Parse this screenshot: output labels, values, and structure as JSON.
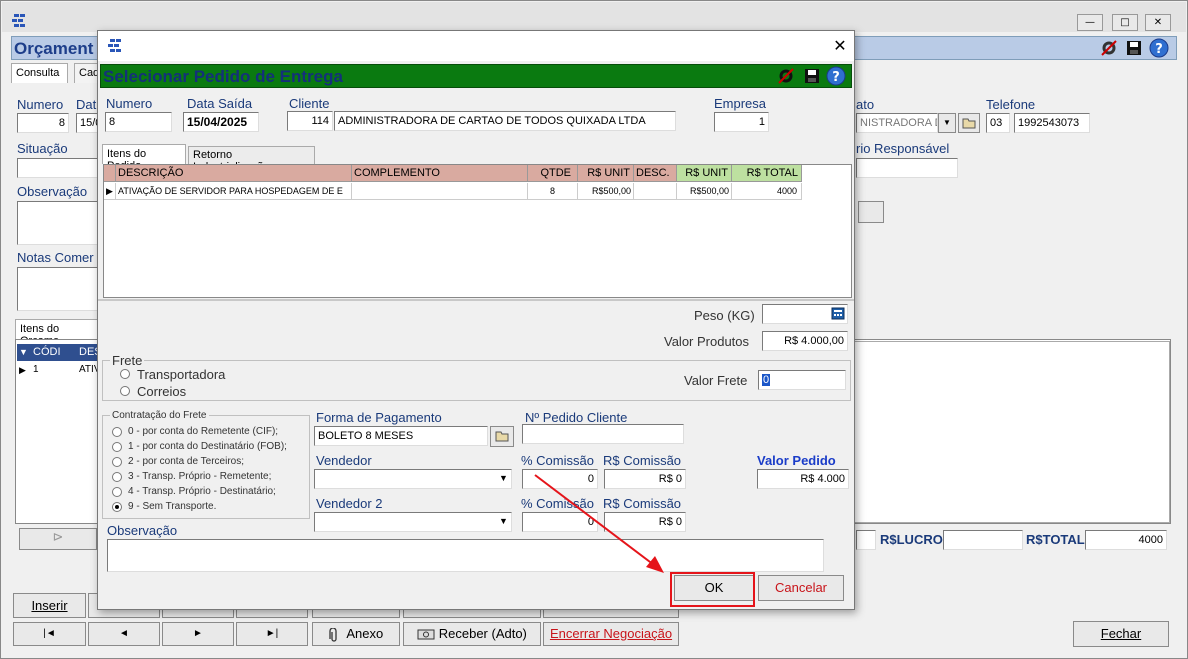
{
  "main": {
    "title": "Orçament",
    "tabs": [
      "Consulta",
      "Cad"
    ],
    "fields": {
      "numero_label": "Numero",
      "numero_value": "8",
      "data_label": "Dat",
      "data_value": "15/0",
      "situacao_label": "Situação",
      "observacao_label": "Observação",
      "notas_label": "Notas Comer",
      "contato_label": "ato",
      "contato_value": "NISTRADORA D",
      "telefone_label": "Telefone",
      "telefone_ddd": "03",
      "telefone_value": "1992543073",
      "responsavel_label": "rio Responsável"
    },
    "itens_tab": "Itens do Orçame",
    "grid_headers": [
      "CÓDI",
      "DES"
    ],
    "grid_row": [
      "1",
      "ATIV"
    ],
    "totals": {
      "lucro_label": "R$LUCRO",
      "total_label": "R$TOTAL",
      "total_value": "4000"
    },
    "buttons": {
      "inserir": "Inserir",
      "anexo": "Anexo",
      "receber": "Receber (Adto)",
      "encerrar": "Encerrar Negociação",
      "fechar": "Fechar",
      "first": "|◄",
      "prev": "◄",
      "next": "►",
      "last": "►|"
    }
  },
  "dialog": {
    "title": "Selecionar Pedido de Entrega",
    "numero_label": "Numero",
    "numero_value": "8",
    "data_saida_label": "Data Saída",
    "data_saida_value": "15/04/2025",
    "cliente_label": "Cliente",
    "cliente_code": "114",
    "cliente_name": "ADMINISTRADORA DE CARTAO DE TODOS QUIXADA LTDA",
    "empresa_label": "Empresa",
    "empresa_value": "1",
    "tabs": [
      "Itens do Pedido",
      "Retorno Industrialização"
    ],
    "grid": {
      "headers": [
        "DESCRIÇÃO",
        "COMPLEMENTO",
        "QTDE",
        "R$ UNIT",
        "DESC.",
        "R$ UNIT",
        "R$ TOTAL"
      ],
      "rows": [
        [
          "ATIVAÇÃO DE SERVIDOR PARA HOSPEDAGEM DE E",
          "",
          "8",
          "R$500,00",
          "",
          "R$500,00",
          "4000"
        ]
      ]
    },
    "peso_label": "Peso (KG)",
    "peso_value": "",
    "valor_produtos_label": "Valor Produtos",
    "valor_produtos_value": "R$ 4.000,00",
    "frete_label": "Frete",
    "frete_options": [
      "Transportadora",
      "Correios"
    ],
    "valor_frete_label": "Valor Frete",
    "valor_frete_value": "0",
    "contratacao_label": "Contratação do Frete",
    "contratacao_options": [
      "0 - por conta do Remetente (CIF);",
      "1 - por conta do Destinatário (FOB);",
      "2 - por conta de Terceiros;",
      "3 - Transp. Próprio - Remetente;",
      "4 - Transp. Próprio - Destinatário;",
      "9 - Sem Transporte."
    ],
    "contratacao_selected": 5,
    "forma_pagamento_label": "Forma de Pagamento",
    "forma_pagamento_value": "BOLETO 8 MESES",
    "pedido_cliente_label": "Nº Pedido Cliente",
    "pedido_cliente_value": "",
    "vendedor_label": "Vendedor",
    "vendedor_value": "",
    "pct_comissao_label": "% Comissão",
    "pct_comissao_value": "0",
    "rs_comissao_label": "R$ Comissão",
    "rs_comissao_value": "R$ 0",
    "valor_pedido_label": "Valor Pedido",
    "valor_pedido_value": "R$ 4.000",
    "vendedor2_label": "Vendedor 2",
    "vendedor2_value": "",
    "pct_comissao2_value": "0",
    "rs_comissao2_value": "R$ 0",
    "observacao_label": "Observação",
    "observacao_value": "",
    "ok_label": "OK",
    "cancelar_label": "Cancelar"
  },
  "colors": {
    "dialog_header": "#0a7a10",
    "main_header": "#b9cbe6",
    "annotation": "#e5141a",
    "valor_pedido": "#1a3cc8",
    "cancelar": "#c8141a"
  },
  "icons": [
    "app-logo-icon",
    "settings-icon",
    "save-icon",
    "help-icon",
    "close-icon",
    "folder-icon",
    "calculator-icon",
    "paperclip-icon",
    "money-icon",
    "dropdown-arrow-icon"
  ]
}
